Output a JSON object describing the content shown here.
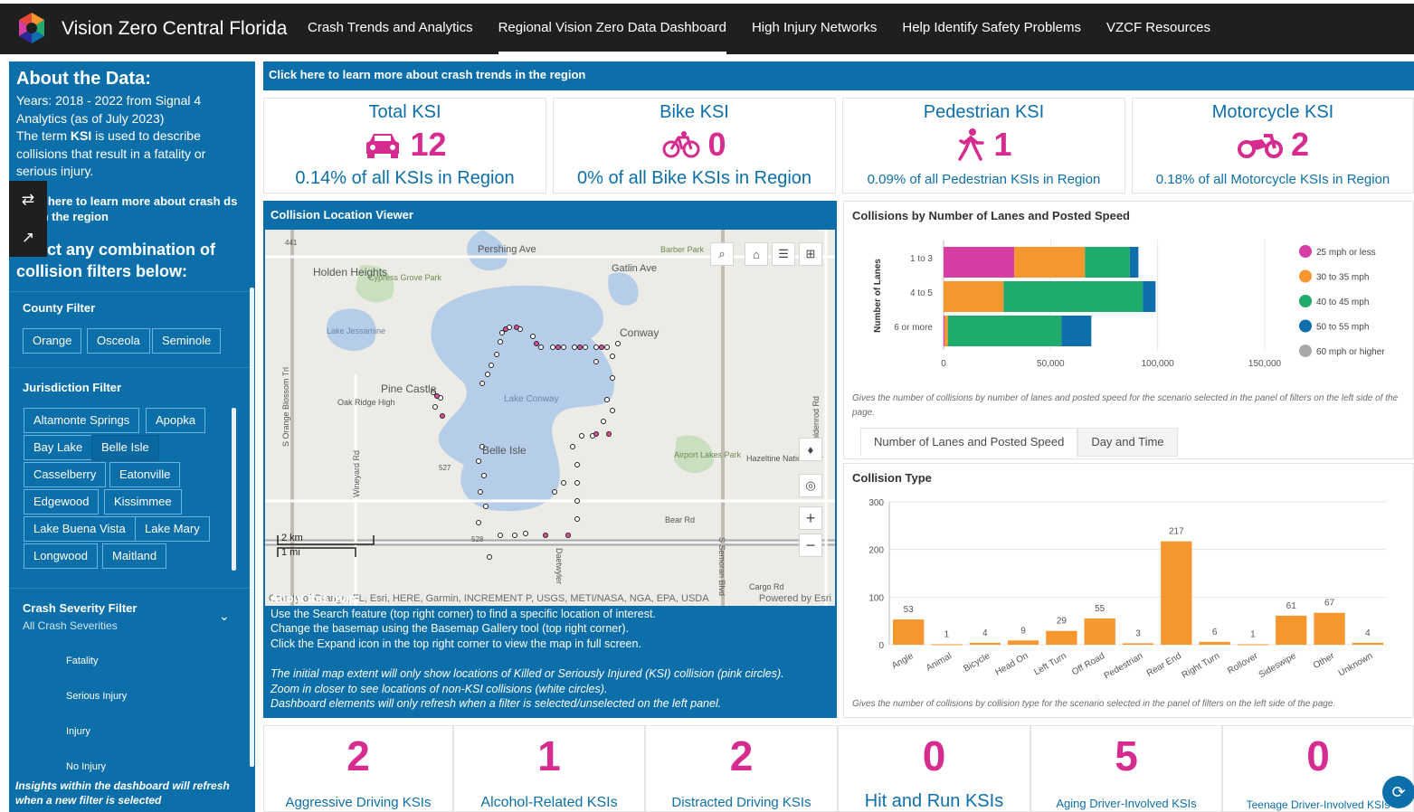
{
  "nav": {
    "brand": "Vision Zero Central Florida",
    "links": [
      "Crash Trends and Analytics",
      "Regional Vision Zero Data Dashboard",
      "High Injury Networks",
      "Help Identify Safety Problems",
      "VZCF Resources"
    ]
  },
  "sidebar": {
    "about_title": "About the Data:",
    "years": "Years: 2018 - 2022 from Signal 4 Analytics (as of July 2023)",
    "ksi_prefix": "The term",
    "ksi_term": "KSI",
    "ksi_suffix": "is used to describe collisions that result in a fatality or serious injury.",
    "learn_more": "k here to learn more about crash ds in the region",
    "select_line1": "ect any combination of",
    "select_line2": "collision filters below:",
    "county_label": "County Filter",
    "counties": [
      "Orange",
      "Osceola",
      "Seminole"
    ],
    "jurisdiction_label": "Jurisdiction Filter",
    "jurisdictions": [
      "Altamonte Springs",
      "Apopka",
      "Bay Lake",
      "Belle Isle",
      "Casselberry",
      "Eatonville",
      "Edgewood",
      "Kissimmee",
      "Lake Buena Vista",
      "Lake Mary",
      "Longwood",
      "Maitland"
    ],
    "severity_label": "Crash Severity Filter",
    "severity_value": "All Crash Severities",
    "severities": [
      "Fatality",
      "Serious Injury",
      "Injury",
      "No Injury"
    ],
    "footer": "Insights within the dashboard will refresh when a new filter is selected"
  },
  "banner": "Click here to learn more about crash trends in the region",
  "kpis": [
    {
      "title": "Total KSI",
      "value": "12",
      "sub": "0.14% of all KSIs in Region",
      "icon": "car-icon"
    },
    {
      "title": "Bike KSI",
      "value": "0",
      "sub": "0% of all Bike KSIs in Region",
      "icon": "bicycle-icon"
    },
    {
      "title": "Pedestrian KSI",
      "value": "1",
      "sub": "0.09% of all Pedestrian KSIs in Region",
      "icon": "pedestrian-icon"
    },
    {
      "title": "Motorcycle KSI",
      "value": "2",
      "sub": "0.18% of all Motorcycle KSIs in Region",
      "icon": "motorcycle-icon"
    }
  ],
  "map": {
    "title": "Collision Location Viewer",
    "labels": [
      "Pershing Ave",
      "Barber Park",
      "Gatlin Ave",
      "Holden Heights",
      "Cypress Grove Park",
      "Lake Jessamine",
      "Conway",
      "Pine Castle",
      "Lake Conway",
      "Oak Ridge High",
      "Belle Isle",
      "Airport Lakes Park",
      "Hazeltine National Dr",
      "Bear Rd",
      "Cargo Rd",
      "S Orange Blossom Trl",
      "S Semoran Blvd",
      "Wineyard Rd",
      "Goldenrod Rd",
      "441",
      "527",
      "528",
      "Daetwyler"
    ],
    "scale_km": "2 km",
    "scale_mi": "1 mi",
    "attribution": "County of Orange, FL, Esri, HERE, Garmin, INCREMENT P, USGS, METI/NASA, NGA, EPA, USDA",
    "powered": "Powered by Esri",
    "about_title": "About this map:",
    "about_lines": [
      "Use the Search feature (top right corner) to find a specific location of interest.",
      "Change the basemap using the Basemap Gallery tool (top right corner).",
      "Click the Expand icon in the top right corner to view the map in full screen."
    ],
    "note_lines": [
      "The initial map extent will only show locations of Killed or Seriously Injured (KSI) collision (pink circles).",
      "Zoom in closer to see locations of non-KSI collisions (white circles).",
      "Dashboard elements will only refresh when a filter is selected/unselected on the left panel."
    ]
  },
  "lanes_chart": {
    "title": "Collisions by Number of Lanes and Posted Speed",
    "note": "Gives the number of collisions by number of lanes and posted speed for the scenario selected in the panel of filters on the left side of the page.",
    "tabs": [
      "Number of Lanes and Posted Speed",
      "Day and Time"
    ]
  },
  "type_chart": {
    "title": "Collision Type",
    "note": "Gives the number of collisions by collision type for the scenario selected in the panel of filters on the left side of the page."
  },
  "chart_data": [
    {
      "type": "bar",
      "orientation": "horizontal-stacked",
      "ylabel": "Number of Lanes",
      "categories": [
        "1 to 3",
        "4 to 5",
        "6 or more"
      ],
      "xlim": [
        0,
        150000
      ],
      "xticks": [
        "0",
        "50,000",
        "100,000",
        "150,000"
      ],
      "legend": "right",
      "series": [
        {
          "name": "25 mph or less",
          "color": "#d63ea4",
          "values": [
            33000,
            0,
            500
          ]
        },
        {
          "name": "30 to 35 mph",
          "color": "#f6962f",
          "values": [
            33000,
            28000,
            1500
          ]
        },
        {
          "name": "40 to 45 mph",
          "color": "#1fab6b",
          "values": [
            21000,
            65000,
            53000
          ]
        },
        {
          "name": "50 to 55 mph",
          "color": "#0f6fad",
          "values": [
            4000,
            6000,
            14000
          ]
        },
        {
          "name": "60 mph or higher",
          "color": "#a8a8a8",
          "values": [
            0,
            0,
            0
          ]
        }
      ]
    },
    {
      "type": "bar",
      "categories": [
        "Angle",
        "Animal",
        "Bicycle",
        "Head On",
        "Left Turn",
        "Off Road",
        "Pedestrian",
        "Rear End",
        "Right Turn",
        "Rollover",
        "Sideswipe",
        "Other",
        "Unknown"
      ],
      "values": [
        53,
        1,
        4,
        9,
        29,
        55,
        3,
        217,
        6,
        1,
        61,
        67,
        4
      ],
      "ylim": [
        0,
        300
      ],
      "yticks": [
        "0",
        "100",
        "200",
        "300"
      ],
      "color": "#f6962f"
    }
  ],
  "metrics": [
    {
      "value": "2",
      "label": "Aggressive Driving KSIs"
    },
    {
      "value": "1",
      "label": "Alcohol-Related KSIs"
    },
    {
      "value": "2",
      "label": "Distracted Driving KSIs"
    },
    {
      "value": "0",
      "label": "Hit and Run KSIs"
    },
    {
      "value": "5",
      "label": "Aging Driver-Involved KSIs"
    },
    {
      "value": "0",
      "label": "Teenage Driver-Involved KSIs"
    }
  ]
}
